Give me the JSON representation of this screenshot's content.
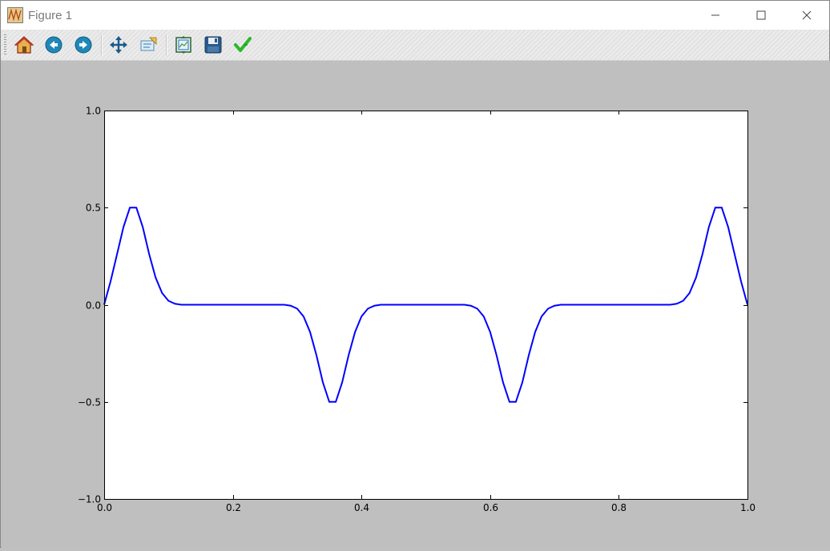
{
  "window": {
    "title": "Figure 1",
    "controls": [
      "minimize",
      "maximize",
      "close"
    ]
  },
  "toolbar": {
    "buttons": [
      {
        "name": "home-icon",
        "tooltip": "Home"
      },
      {
        "name": "back-icon",
        "tooltip": "Back"
      },
      {
        "name": "forward-icon",
        "tooltip": "Forward"
      },
      {
        "name": "pan-icon",
        "tooltip": "Pan"
      },
      {
        "name": "zoom-icon",
        "tooltip": "Zoom"
      },
      {
        "name": "subplots-icon",
        "tooltip": "Configure subplots"
      },
      {
        "name": "save-icon",
        "tooltip": "Save"
      },
      {
        "name": "edit-icon",
        "tooltip": "Edit parameters"
      }
    ]
  },
  "colors": {
    "figure_bg": "#bfbfbf",
    "axes_bg": "#ffffff",
    "line": "#0000ff"
  },
  "chart_data": {
    "type": "line",
    "title": "",
    "xlabel": "",
    "ylabel": "",
    "xlim": [
      0.0,
      1.0
    ],
    "ylim": [
      -1.0,
      1.0
    ],
    "xticks": [
      "0.0",
      "0.2",
      "0.4",
      "0.6",
      "0.8",
      "1.0"
    ],
    "yticks": [
      "−1.0",
      "−0.5",
      "0.0",
      "0.5",
      "1.0"
    ],
    "grid": false,
    "legend": null,
    "series": [
      {
        "x": [
          0.0,
          0.01,
          0.02,
          0.03,
          0.04,
          0.05,
          0.06,
          0.07,
          0.08,
          0.09,
          0.1,
          0.11,
          0.12,
          0.14,
          0.2,
          0.26,
          0.28,
          0.29,
          0.3,
          0.31,
          0.32,
          0.33,
          0.34,
          0.35,
          0.36,
          0.37,
          0.38,
          0.39,
          0.4,
          0.41,
          0.42,
          0.43,
          0.44,
          0.46,
          0.5,
          0.54,
          0.56,
          0.57,
          0.58,
          0.59,
          0.6,
          0.61,
          0.62,
          0.63,
          0.64,
          0.65,
          0.66,
          0.67,
          0.68,
          0.69,
          0.7,
          0.71,
          0.72,
          0.74,
          0.8,
          0.86,
          0.88,
          0.89,
          0.9,
          0.91,
          0.92,
          0.93,
          0.94,
          0.95,
          0.96,
          0.97,
          0.98,
          0.99,
          1.0
        ],
        "y": [
          0.0,
          0.12,
          0.26,
          0.4,
          0.5,
          0.5,
          0.4,
          0.26,
          0.14,
          0.06,
          0.02,
          0.005,
          0.0,
          0.0,
          0.0,
          0.0,
          0.0,
          -0.005,
          -0.02,
          -0.06,
          -0.14,
          -0.26,
          -0.4,
          -0.5,
          -0.5,
          -0.4,
          -0.26,
          -0.14,
          -0.06,
          -0.02,
          -0.005,
          0.0,
          0.0,
          0.0,
          0.0,
          0.0,
          0.0,
          -0.005,
          -0.02,
          -0.06,
          -0.14,
          -0.26,
          -0.4,
          -0.5,
          -0.5,
          -0.4,
          -0.26,
          -0.14,
          -0.06,
          -0.02,
          -0.005,
          0.0,
          0.0,
          0.0,
          0.0,
          0.0,
          0.0,
          0.005,
          0.02,
          0.06,
          0.14,
          0.26,
          0.4,
          0.5,
          0.5,
          0.4,
          0.26,
          0.12,
          0.0
        ]
      }
    ]
  }
}
